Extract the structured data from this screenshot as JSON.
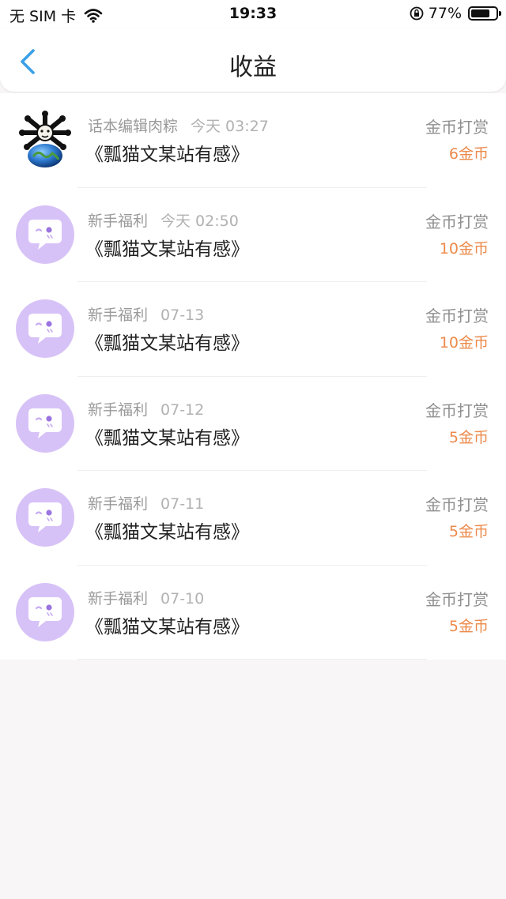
{
  "status_bar": {
    "carrier": "无 SIM 卡",
    "time": "19:33",
    "battery": "77%",
    "battery_level": 0.77
  },
  "nav": {
    "title": "收益"
  },
  "rows": [
    {
      "author": "话本编辑肉粽",
      "time": "今天 03:27",
      "title": "《瓢猫文某站有感》",
      "type": "金币打赏",
      "amount": "6金币",
      "avatar": "photo"
    },
    {
      "author": "新手福利",
      "time": "今天 02:50",
      "title": "《瓢猫文某站有感》",
      "type": "金币打赏",
      "amount": "10金币",
      "avatar": "chat-bubble-face"
    },
    {
      "author": "新手福利",
      "time": "07-13",
      "title": "《瓢猫文某站有感》",
      "type": "金币打赏",
      "amount": "10金币",
      "avatar": "chat-bubble-face"
    },
    {
      "author": "新手福利",
      "time": "07-12",
      "title": "《瓢猫文某站有感》",
      "type": "金币打赏",
      "amount": "5金币",
      "avatar": "chat-bubble-face"
    },
    {
      "author": "新手福利",
      "time": "07-11",
      "title": "《瓢猫文某站有感》",
      "type": "金币打赏",
      "amount": "5金币",
      "avatar": "chat-bubble-face"
    },
    {
      "author": "新手福利",
      "time": "07-10",
      "title": "《瓢猫文某站有感》",
      "type": "金币打赏",
      "amount": "5金币",
      "avatar": "chat-bubble-face"
    }
  ],
  "colors": {
    "accent_blue": "#3aa0e8",
    "amount_orange": "#ec8a4a",
    "avatar_purple": "#d7c2f7",
    "background": "#f8f6f7"
  }
}
